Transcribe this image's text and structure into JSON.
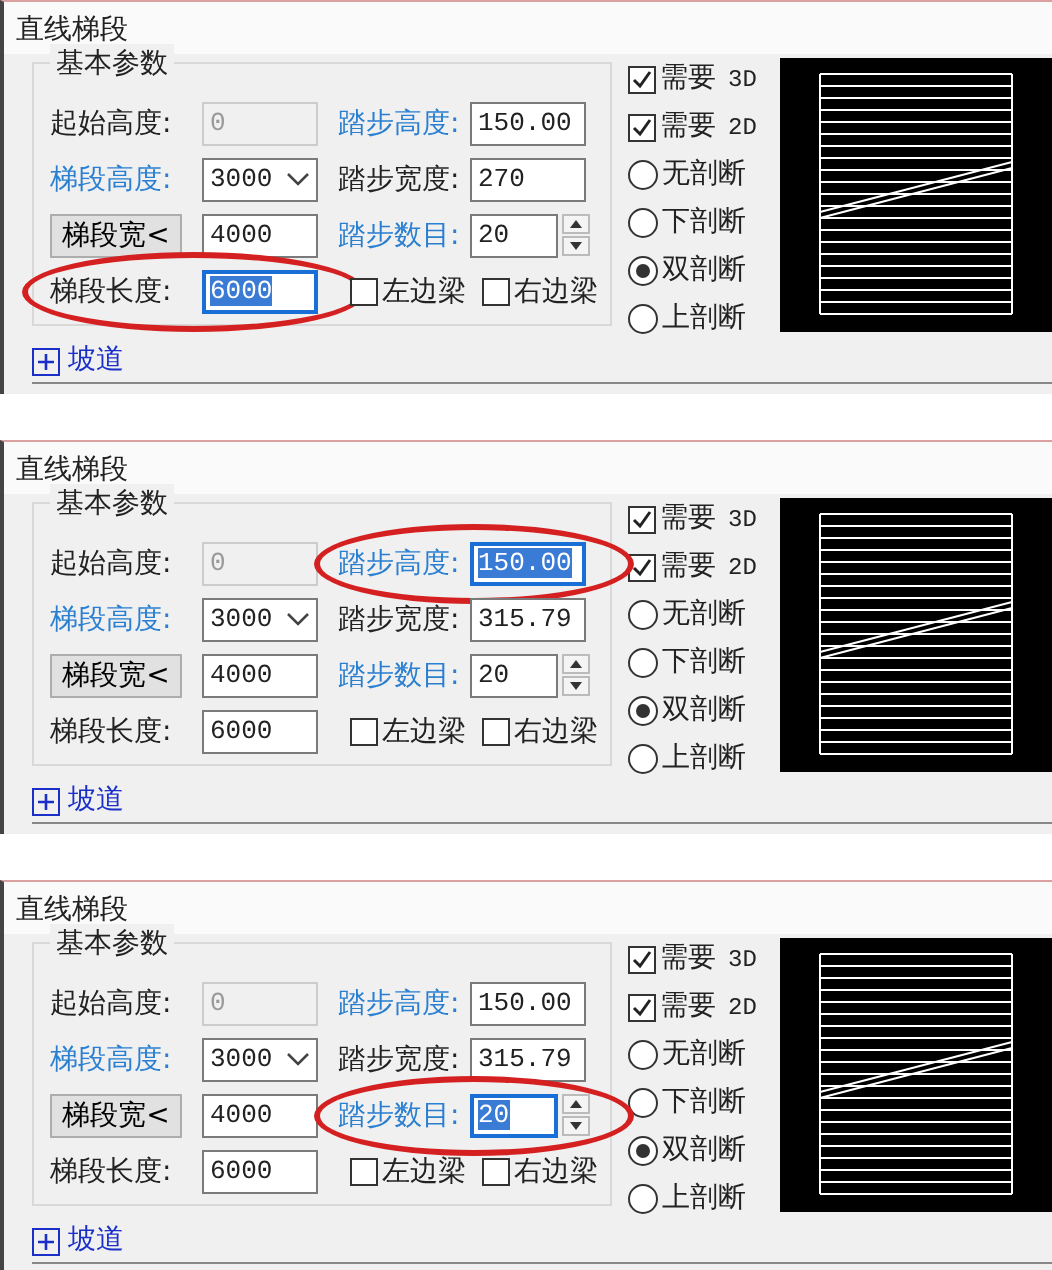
{
  "panels": [
    {
      "title": "直线梯段",
      "group_title": "基本参数",
      "rows": [
        {
          "cells": [
            {
              "kind": "field",
              "label": "起始高度:",
              "emphasized": false,
              "value": "0",
              "disabled": true,
              "focused": false,
              "circled": false
            },
            {
              "kind": "field",
              "label": "踏步高度:",
              "emphasized": true,
              "value": "150.00",
              "disabled": false,
              "focused": false,
              "circled": false
            }
          ]
        },
        {
          "cells": [
            {
              "kind": "combo",
              "label": "梯段高度:",
              "emphasized": true,
              "value": "3000",
              "disabled": false,
              "focused": false,
              "circled": false
            },
            {
              "kind": "field",
              "label": "踏步宽度:",
              "emphasized": false,
              "value": "270",
              "disabled": false,
              "focused": false,
              "circled": false
            }
          ]
        },
        {
          "cells": [
            {
              "kind": "button-field",
              "label": "梯段宽<",
              "value": "4000",
              "disabled": false,
              "focused": false,
              "circled": false
            },
            {
              "kind": "spin",
              "label": "踏步数目:",
              "emphasized": true,
              "value": "20",
              "disabled": false,
              "focused": false,
              "circled": false
            }
          ]
        },
        {
          "cells": [
            {
              "kind": "field",
              "label": "梯段长度:",
              "emphasized": false,
              "value": "6000",
              "disabled": false,
              "focused": true,
              "circled": true
            },
            {
              "kind": "checks",
              "items": [
                {
                  "label": "左边梁",
                  "checked": false
                },
                {
                  "label": "右边梁",
                  "checked": false
                }
              ]
            }
          ]
        }
      ],
      "options": [
        {
          "label": "需要",
          "suffix": "3D",
          "checked": true
        },
        {
          "label": "需要",
          "suffix": "2D",
          "checked": true
        }
      ],
      "sections": [
        {
          "label": "无剖断",
          "selected": false
        },
        {
          "label": "下剖断",
          "selected": false
        },
        {
          "label": "双剖断",
          "selected": true
        },
        {
          "label": "上剖断",
          "selected": false
        }
      ],
      "footer": "坡道"
    },
    {
      "title": "直线梯段",
      "group_title": "基本参数",
      "rows": [
        {
          "cells": [
            {
              "kind": "field",
              "label": "起始高度:",
              "emphasized": false,
              "value": "0",
              "disabled": true,
              "focused": false,
              "circled": false
            },
            {
              "kind": "field",
              "label": "踏步高度:",
              "emphasized": true,
              "value": "150.00",
              "disabled": false,
              "focused": true,
              "circled": true
            }
          ]
        },
        {
          "cells": [
            {
              "kind": "combo",
              "label": "梯段高度:",
              "emphasized": true,
              "value": "3000",
              "disabled": false,
              "focused": false,
              "circled": false
            },
            {
              "kind": "field",
              "label": "踏步宽度:",
              "emphasized": false,
              "value": "315.79",
              "disabled": false,
              "focused": false,
              "circled": false
            }
          ]
        },
        {
          "cells": [
            {
              "kind": "button-field",
              "label": "梯段宽<",
              "value": "4000",
              "disabled": false,
              "focused": false,
              "circled": false
            },
            {
              "kind": "spin",
              "label": "踏步数目:",
              "emphasized": true,
              "value": "20",
              "disabled": false,
              "focused": false,
              "circled": false
            }
          ]
        },
        {
          "cells": [
            {
              "kind": "field",
              "label": "梯段长度:",
              "emphasized": false,
              "value": "6000",
              "disabled": false,
              "focused": false,
              "circled": false
            },
            {
              "kind": "checks",
              "items": [
                {
                  "label": "左边梁",
                  "checked": false
                },
                {
                  "label": "右边梁",
                  "checked": false
                }
              ]
            }
          ]
        }
      ],
      "options": [
        {
          "label": "需要",
          "suffix": "3D",
          "checked": true
        },
        {
          "label": "需要",
          "suffix": "2D",
          "checked": true
        }
      ],
      "sections": [
        {
          "label": "无剖断",
          "selected": false
        },
        {
          "label": "下剖断",
          "selected": false
        },
        {
          "label": "双剖断",
          "selected": true
        },
        {
          "label": "上剖断",
          "selected": false
        }
      ],
      "footer": "坡道"
    },
    {
      "title": "直线梯段",
      "group_title": "基本参数",
      "rows": [
        {
          "cells": [
            {
              "kind": "field",
              "label": "起始高度:",
              "emphasized": false,
              "value": "0",
              "disabled": true,
              "focused": false,
              "circled": false
            },
            {
              "kind": "field",
              "label": "踏步高度:",
              "emphasized": true,
              "value": "150.00",
              "disabled": false,
              "focused": false,
              "circled": false
            }
          ]
        },
        {
          "cells": [
            {
              "kind": "combo",
              "label": "梯段高度:",
              "emphasized": true,
              "value": "3000",
              "disabled": false,
              "focused": false,
              "circled": false
            },
            {
              "kind": "field",
              "label": "踏步宽度:",
              "emphasized": false,
              "value": "315.79",
              "disabled": false,
              "focused": false,
              "circled": false
            }
          ]
        },
        {
          "cells": [
            {
              "kind": "button-field",
              "label": "梯段宽<",
              "value": "4000",
              "disabled": false,
              "focused": false,
              "circled": false
            },
            {
              "kind": "spin",
              "label": "踏步数目:",
              "emphasized": true,
              "value": "20",
              "disabled": false,
              "focused": true,
              "circled": true
            }
          ]
        },
        {
          "cells": [
            {
              "kind": "field",
              "label": "梯段长度:",
              "emphasized": false,
              "value": "6000",
              "disabled": false,
              "focused": false,
              "circled": false
            },
            {
              "kind": "checks",
              "items": [
                {
                  "label": "左边梁",
                  "checked": false
                },
                {
                  "label": "右边梁",
                  "checked": false
                }
              ]
            }
          ]
        }
      ],
      "options": [
        {
          "label": "需要",
          "suffix": "3D",
          "checked": true
        },
        {
          "label": "需要",
          "suffix": "2D",
          "checked": true
        }
      ],
      "sections": [
        {
          "label": "无剖断",
          "selected": false
        },
        {
          "label": "下剖断",
          "selected": false
        },
        {
          "label": "双剖断",
          "selected": true
        },
        {
          "label": "上剖断",
          "selected": false
        }
      ],
      "footer": "坡道"
    }
  ]
}
